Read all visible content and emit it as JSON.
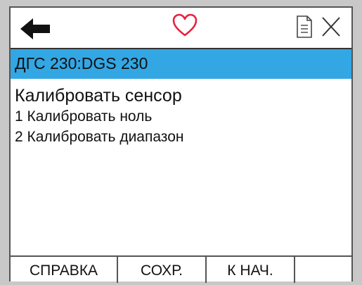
{
  "colors": {
    "titlebar": "#33a6e4",
    "heart": "#e8213f",
    "background": "#ffffff"
  },
  "icons": [
    "back-arrow-icon",
    "heart-icon",
    "document-icon",
    "close-icon"
  ],
  "titlebar": {
    "title": "ДГС 230:DGS 230"
  },
  "menu": {
    "heading": "Калибровать сенсор",
    "items": [
      {
        "label": "1 Калибровать ноль"
      },
      {
        "label": "2 Калибровать диапазон"
      }
    ]
  },
  "softkeys": {
    "help": "СПРАВКА",
    "save": "СОХР.",
    "home": "К НАЧ."
  }
}
